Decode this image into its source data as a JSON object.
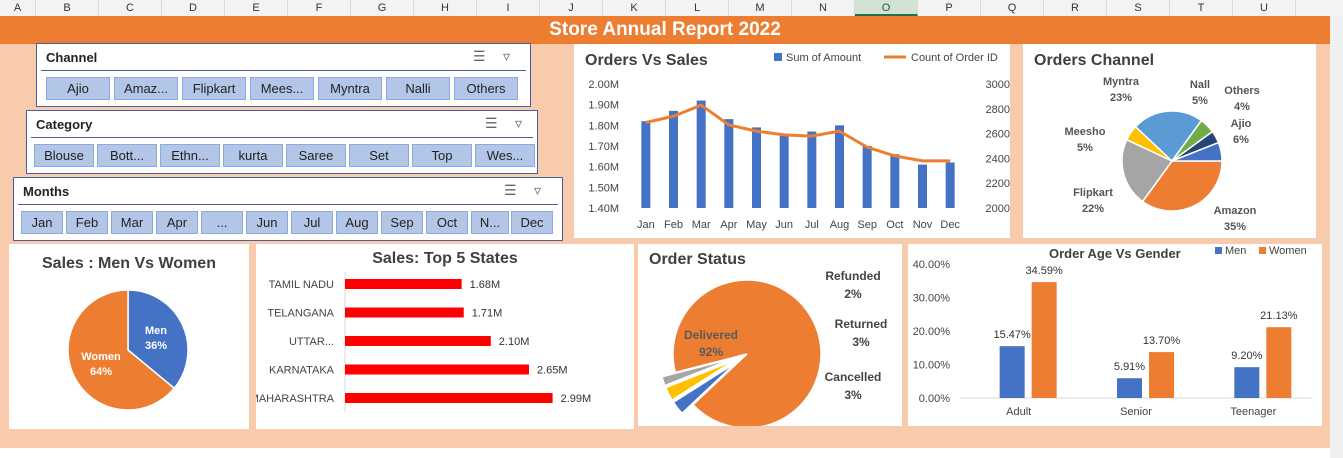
{
  "columns": [
    "A",
    "B",
    "C",
    "D",
    "E",
    "F",
    "G",
    "H",
    "I",
    "J",
    "K",
    "L",
    "M",
    "N",
    "O",
    "P",
    "Q",
    "R",
    "S",
    "T",
    "U"
  ],
  "selected_column": "O",
  "report_title": "Store Annual Report 2022",
  "slicers": {
    "channel": {
      "title": "Channel",
      "items": [
        "Ajio",
        "Amaz...",
        "Flipkart",
        "Mees...",
        "Myntra",
        "Nalli",
        "Others"
      ]
    },
    "category": {
      "title": "Category",
      "items": [
        "Blouse",
        "Bott...",
        "Ethn...",
        "kurta",
        "Saree",
        "Set",
        "Top",
        "Wes..."
      ]
    },
    "months": {
      "title": "Months",
      "items": [
        "Jan",
        "Feb",
        "Mar",
        "Apr",
        "...",
        "Jun",
        "Jul",
        "Aug",
        "Sep",
        "Oct",
        "N...",
        "Dec"
      ]
    }
  },
  "colors": {
    "blue": "#4472c4",
    "orange": "#ed7d31",
    "red": "#ff0000",
    "gray": "#a5a5a5",
    "yellow": "#ffc000",
    "lightblue": "#5b9bd5",
    "green": "#70ad47",
    "navy": "#264478"
  },
  "chart_data": [
    {
      "id": "orders_vs_sales",
      "type": "bar",
      "title": "Orders Vs Sales",
      "categories": [
        "Jan",
        "Feb",
        "Mar",
        "Apr",
        "May",
        "Jun",
        "Jul",
        "Aug",
        "Sep",
        "Oct",
        "Nov",
        "Dec"
      ],
      "series": [
        {
          "name": "Sum of Amount",
          "type": "bar",
          "axis": "left",
          "values": [
            1820000,
            1870000,
            1920000,
            1830000,
            1790000,
            1750000,
            1770000,
            1800000,
            1700000,
            1660000,
            1610000,
            1620000
          ]
        },
        {
          "name": "Count of Order ID",
          "type": "line",
          "axis": "right",
          "values": [
            2690,
            2740,
            2830,
            2670,
            2620,
            2590,
            2580,
            2620,
            2490,
            2420,
            2380,
            2380
          ]
        }
      ],
      "ylim": [
        1400000,
        2000000
      ],
      "y2lim": [
        2000,
        3000
      ],
      "yticks": [
        "2.00M",
        "1.90M",
        "1.80M",
        "1.70M",
        "1.60M",
        "1.50M",
        "1.40M"
      ],
      "y2ticks": [
        "3000",
        "2800",
        "2600",
        "2400",
        "2200",
        "2000"
      ],
      "legend": "top"
    },
    {
      "id": "orders_channel",
      "type": "pie",
      "title": "Orders Channel",
      "slices": [
        {
          "label": "Amazon",
          "pct_label": "35%",
          "value": 35,
          "color": "#ed7d31"
        },
        {
          "label": "Flipkart",
          "pct_label": "22%",
          "value": 22,
          "color": "#a5a5a5"
        },
        {
          "label": "Meesho",
          "pct_label": "5%",
          "value": 5,
          "color": "#ffc000"
        },
        {
          "label": "Myntra",
          "pct_label": "23%",
          "value": 23,
          "color": "#5b9bd5"
        },
        {
          "label": "Nalli",
          "pct_label": "5%",
          "value": 5,
          "color": "#70ad47"
        },
        {
          "label": "Others",
          "pct_label": "4%",
          "value": 4,
          "color": "#264478"
        },
        {
          "label": "Ajio",
          "pct_label": "6%",
          "value": 6,
          "color": "#4472c4"
        }
      ],
      "slice_labels": [
        {
          "name": "Myntra",
          "pct": "23%"
        },
        {
          "name": "Nall",
          "pct": "5%"
        },
        {
          "name": "Others",
          "pct": "4%"
        },
        {
          "name": "Ajio",
          "pct": "6%"
        },
        {
          "name": "Meesho",
          "pct": "5%"
        },
        {
          "name": "Flipkart",
          "pct": "22%"
        },
        {
          "name": "Amazon",
          "pct": "35%"
        }
      ]
    },
    {
      "id": "men_vs_women",
      "type": "pie",
      "title": "Sales : Men Vs Women",
      "slices": [
        {
          "label": "Men",
          "pct_label": "36%",
          "value": 36,
          "color": "#4472c4"
        },
        {
          "label": "Women",
          "pct_label": "64%",
          "value": 64,
          "color": "#ed7d31"
        }
      ]
    },
    {
      "id": "top5_states",
      "type": "bar",
      "orientation": "horizontal",
      "title": "Sales: Top 5 States",
      "categories": [
        "TAMIL NADU",
        "TELANGANA",
        "UTTAR...",
        "KARNATAKA",
        "MAHARASHTRA"
      ],
      "values": [
        1680000,
        1710000,
        2100000,
        2650000,
        2990000
      ],
      "value_labels": [
        "1.68M",
        "1.71M",
        "2.10M",
        "2.65M",
        "2.99M"
      ],
      "xlim": [
        0,
        3500000
      ],
      "color": "#ff0000"
    },
    {
      "id": "order_status",
      "type": "pie",
      "title": "Order Status",
      "slices": [
        {
          "label": "Delivered",
          "pct_label": "92%",
          "value": 92,
          "color": "#ed7d31"
        },
        {
          "label": "Cancelled",
          "pct_label": "3%",
          "value": 3,
          "color": "#4472c4"
        },
        {
          "label": "Returned",
          "pct_label": "3%",
          "value": 3,
          "color": "#ffc000"
        },
        {
          "label": "Refunded",
          "pct_label": "2%",
          "value": 2,
          "color": "#a5a5a5"
        }
      ]
    },
    {
      "id": "age_vs_gender",
      "type": "bar",
      "title": "Order Age Vs Gender",
      "categories": [
        "Adult",
        "Senior",
        "Teenager"
      ],
      "series": [
        {
          "name": "Men",
          "values": [
            15.47,
            5.91,
            9.2
          ],
          "labels": [
            "15.47%",
            "5.91%",
            "9.20%"
          ],
          "color": "#4472c4"
        },
        {
          "name": "Women",
          "values": [
            34.59,
            13.7,
            21.13
          ],
          "labels": [
            "34.59%",
            "13.70%",
            "21.13%"
          ],
          "color": "#ed7d31"
        }
      ],
      "ylim": [
        0,
        40
      ],
      "yticks": [
        "40.00%",
        "30.00%",
        "20.00%",
        "10.00%",
        "0.00%"
      ],
      "legend": "top-right"
    }
  ]
}
